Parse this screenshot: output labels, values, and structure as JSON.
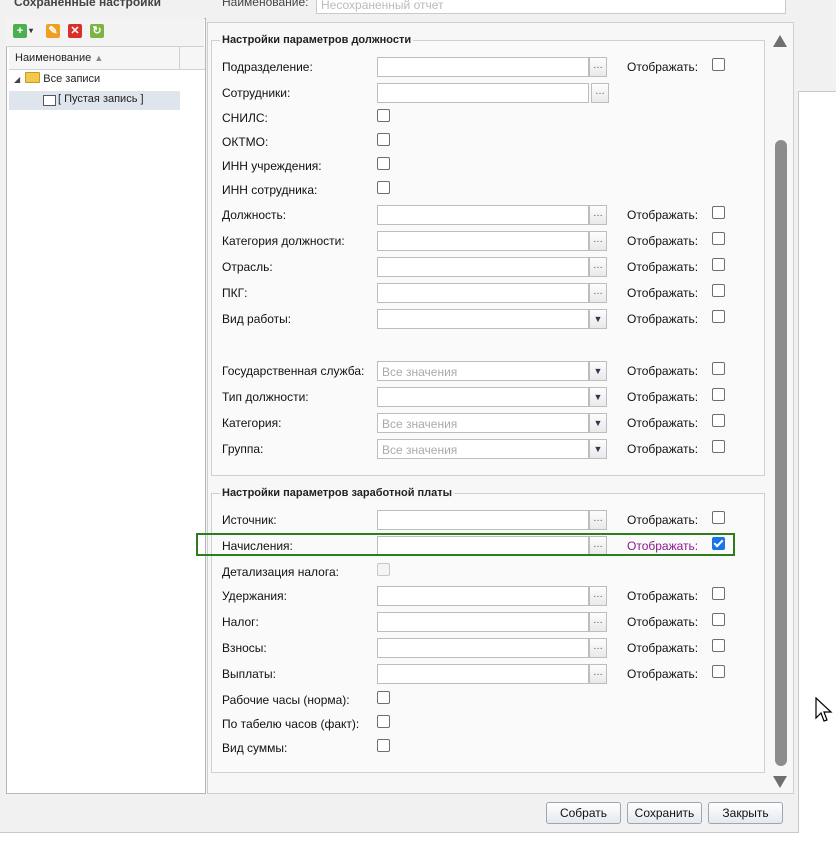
{
  "left_panel": {
    "title": "Сохраненные настройки",
    "column_header": "Наименование",
    "tree": [
      {
        "label": "Все записи"
      },
      {
        "label": "[ Пустая запись ]"
      }
    ]
  },
  "top_field": {
    "label": "Наименование:",
    "placeholder": "Несохраненный отчет"
  },
  "show_label": "Отображать:",
  "position_section": {
    "title": "Настройки параметров должности",
    "rows": [
      {
        "label": "Подразделение:",
        "control": "lookup",
        "show": true,
        "checked": false
      },
      {
        "label": "Сотрудники:",
        "control": "lookup",
        "show": false
      },
      {
        "label": "СНИЛС:",
        "control": "checkbox",
        "checked": false
      },
      {
        "label": "ОКТМО:",
        "control": "checkbox",
        "checked": false
      },
      {
        "label": "ИНН учреждения:",
        "control": "checkbox",
        "checked": false
      },
      {
        "label": "ИНН сотрудника:",
        "control": "checkbox",
        "checked": false
      },
      {
        "label": "Должность:",
        "control": "lookup",
        "show": true,
        "checked": false
      },
      {
        "label": "Категория должности:",
        "control": "lookup",
        "show": true,
        "checked": false
      },
      {
        "label": "Отрасль:",
        "control": "lookup",
        "show": true,
        "checked": false
      },
      {
        "label": "ПКГ:",
        "control": "lookup",
        "show": true,
        "checked": false
      },
      {
        "label": "Вид работы:",
        "control": "combo",
        "placeholder": "",
        "show": true,
        "checked": false
      },
      {
        "label": "Государственная служба:",
        "control": "combo",
        "placeholder": "Все значения",
        "show": true,
        "checked": false
      },
      {
        "label": "Тип должности:",
        "control": "combo",
        "placeholder": "",
        "show": true,
        "checked": false
      },
      {
        "label": "Категория:",
        "control": "combo",
        "placeholder": "Все значения",
        "show": true,
        "checked": false
      },
      {
        "label": "Группа:",
        "control": "combo",
        "placeholder": "Все значения",
        "show": true,
        "checked": false
      }
    ]
  },
  "salary_section": {
    "title": "Настройки параметров заработной платы",
    "rows": [
      {
        "label": "Источник:",
        "control": "lookup",
        "show": true,
        "checked": false
      },
      {
        "label": "Начисления:",
        "control": "lookup",
        "show": true,
        "checked": true,
        "highlighted": true
      },
      {
        "label": "Детализация налога:",
        "control": "checkbox",
        "checked": false,
        "disabled": true
      },
      {
        "label": "Удержания:",
        "control": "lookup",
        "show": true,
        "checked": false
      },
      {
        "label": "Налог:",
        "control": "lookup",
        "show": true,
        "checked": false
      },
      {
        "label": "Взносы:",
        "control": "lookup",
        "show": true,
        "checked": false
      },
      {
        "label": "Выплаты:",
        "control": "lookup",
        "show": true,
        "checked": false
      },
      {
        "label": "Рабочие часы (норма):",
        "control": "checkbox",
        "checked": false
      },
      {
        "label": "По табелю часов (факт):",
        "control": "checkbox",
        "checked": false
      },
      {
        "label": "Вид суммы:",
        "control": "checkbox",
        "checked": false
      }
    ]
  },
  "buttons": {
    "collect": "Собрать",
    "save": "Сохранить",
    "close": "Закрыть"
  },
  "colors": {
    "highlight_border": "#2e7d1c",
    "highlight_text": "#8b1a8b",
    "checkbox_checked": "#1a73e8"
  }
}
